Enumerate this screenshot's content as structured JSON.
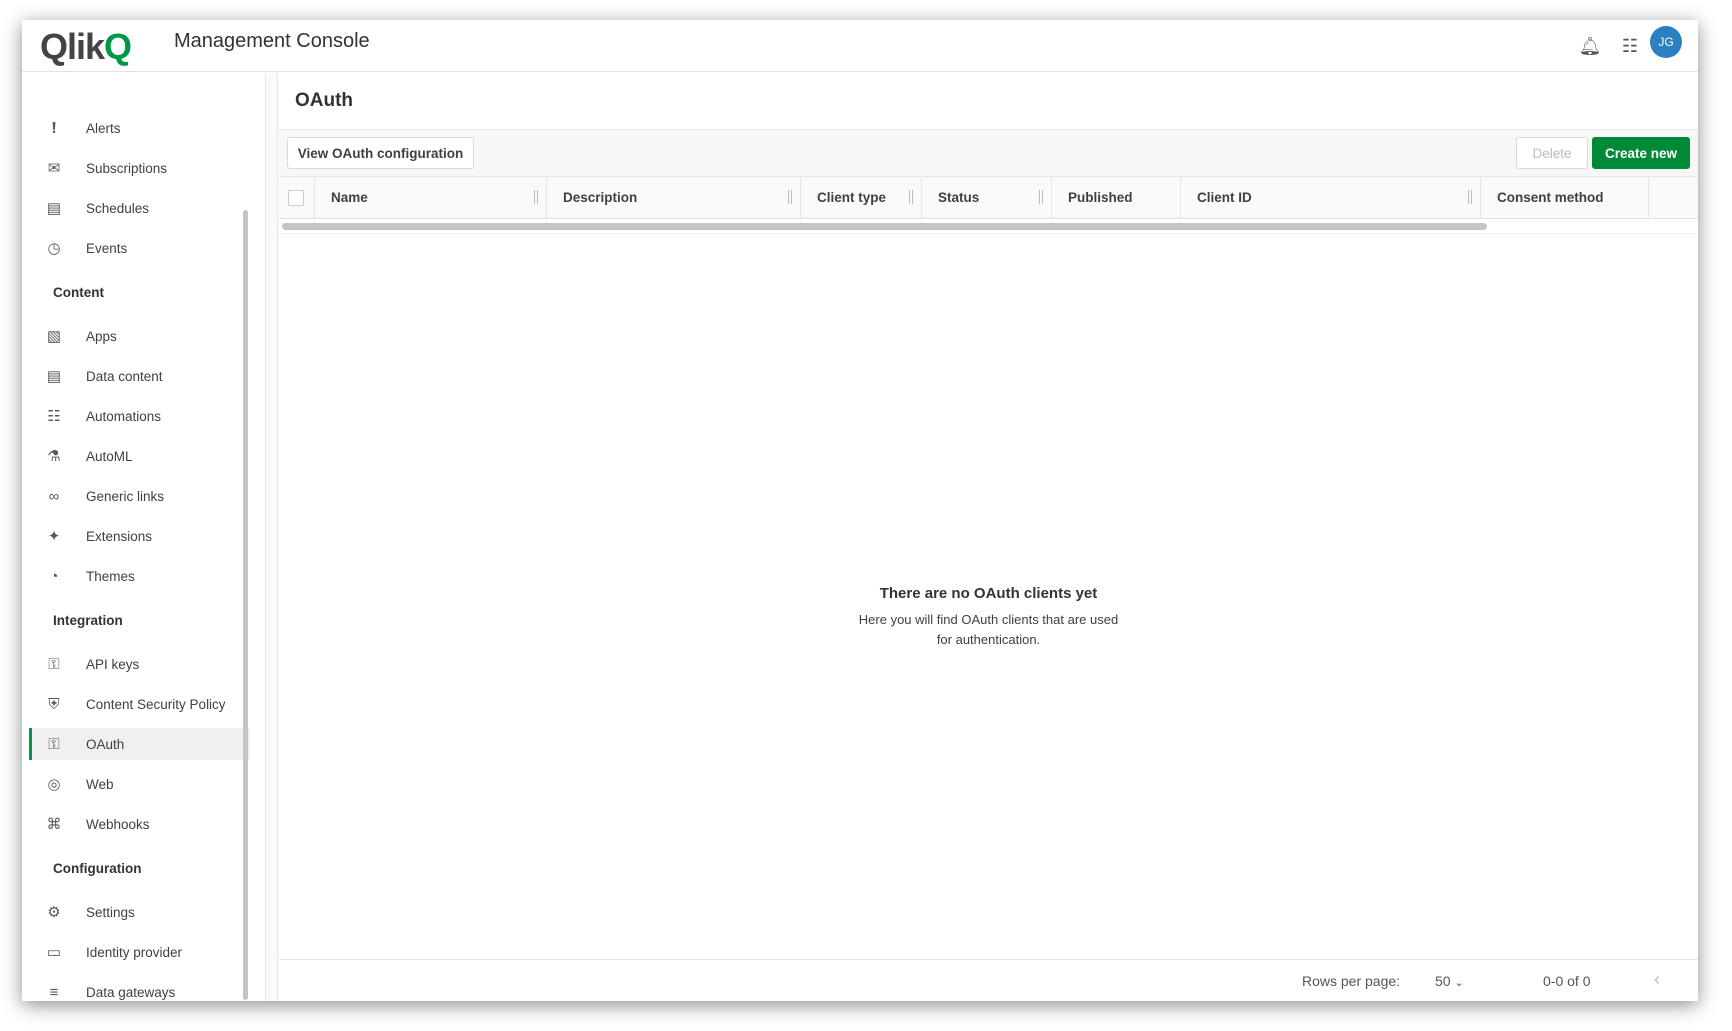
{
  "header": {
    "logo": "Qlik",
    "title": "Management Console",
    "avatar_initials": "JG",
    "icons": [
      "bell-icon",
      "apps-grid-icon"
    ]
  },
  "sidebar": {
    "items_top": [
      {
        "label": "Alerts",
        "icon": "alert-icon"
      },
      {
        "label": "Subscriptions",
        "icon": "envelope-icon"
      },
      {
        "label": "Schedules",
        "icon": "calendar-clock-icon"
      },
      {
        "label": "Events",
        "icon": "clock-icon"
      }
    ],
    "sections": [
      {
        "title": "Content",
        "items": [
          {
            "label": "Apps",
            "icon": "chart-icon"
          },
          {
            "label": "Data content",
            "icon": "database-icon"
          },
          {
            "label": "Automations",
            "icon": "automation-icon"
          },
          {
            "label": "AutoML",
            "icon": "flask-icon"
          },
          {
            "label": "Generic links",
            "icon": "link-icon"
          },
          {
            "label": "Extensions",
            "icon": "puzzle-icon"
          },
          {
            "label": "Themes",
            "icon": "palette-icon"
          }
        ]
      },
      {
        "title": "Integration",
        "items": [
          {
            "label": "API keys",
            "icon": "key-icon"
          },
          {
            "label": "Content Security Policy",
            "icon": "shield-icon"
          },
          {
            "label": "OAuth",
            "icon": "key-icon",
            "active": true
          },
          {
            "label": "Web",
            "icon": "globe-icon"
          },
          {
            "label": "Webhooks",
            "icon": "webhook-icon"
          }
        ]
      },
      {
        "title": "Configuration",
        "items": [
          {
            "label": "Settings",
            "icon": "gear-icon"
          },
          {
            "label": "Identity provider",
            "icon": "id-card-icon"
          },
          {
            "label": "Data gateways",
            "icon": "gateway-icon"
          }
        ]
      }
    ]
  },
  "main": {
    "title": "OAuth",
    "view_config_label": "View OAuth configuration",
    "delete_label": "Delete",
    "create_label": "Create new",
    "columns": [
      "Name",
      "Description",
      "Client type",
      "Status",
      "Published",
      "Client ID",
      "Consent method"
    ],
    "empty_title": "There are no OAuth clients yet",
    "empty_text": "Here you will find OAuth clients that are used for authentication.",
    "footer": {
      "rows_per_page_label": "Rows per page:",
      "rows_per_page": "50",
      "range": "0-0 of 0"
    }
  },
  "colors": {
    "brand": "#009845",
    "primary_button": "#008936",
    "avatar": "#2a80c0"
  }
}
